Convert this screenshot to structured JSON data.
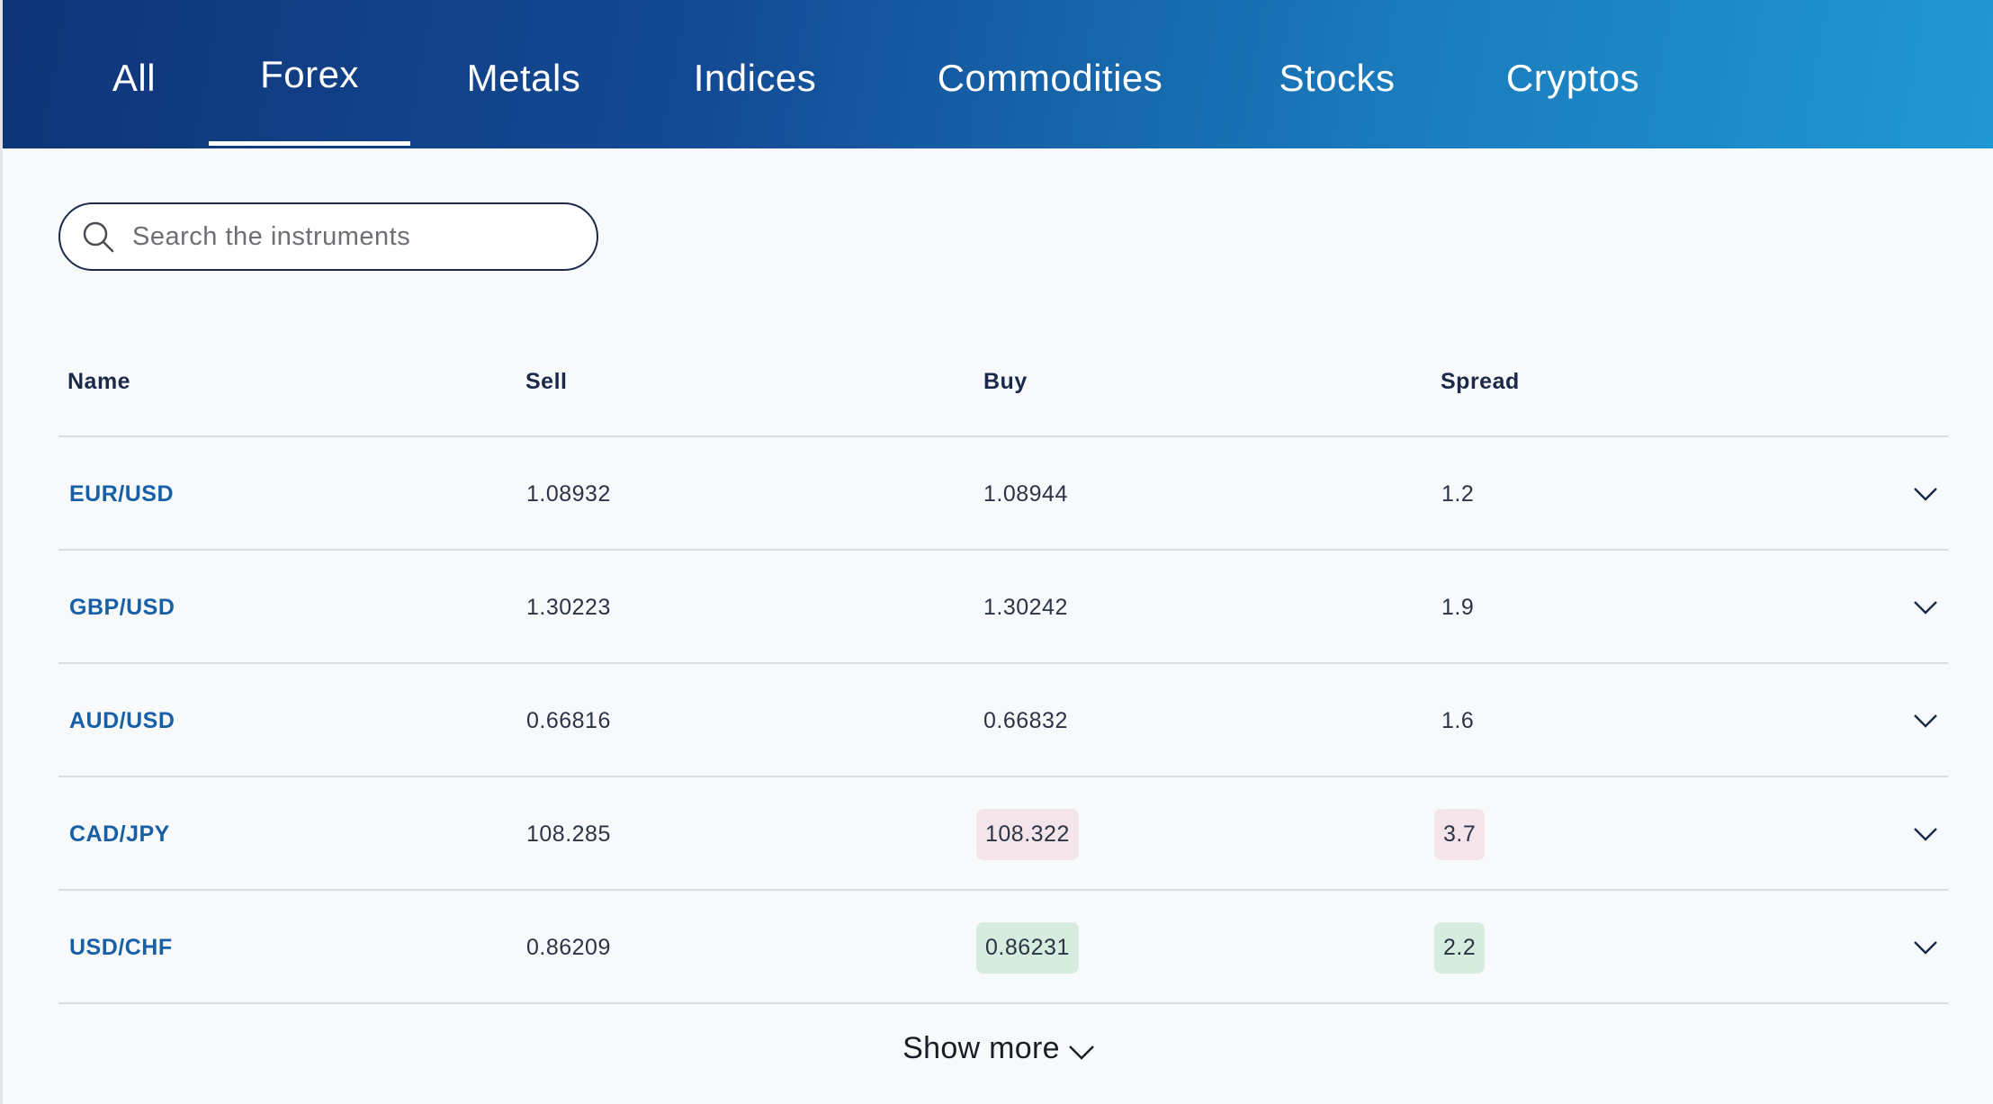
{
  "tabs": [
    {
      "label": "All",
      "active": false
    },
    {
      "label": "Forex",
      "active": true
    },
    {
      "label": "Metals",
      "active": false
    },
    {
      "label": "Indices",
      "active": false
    },
    {
      "label": "Commodities",
      "active": false
    },
    {
      "label": "Stocks",
      "active": false
    },
    {
      "label": "Cryptos",
      "active": false
    }
  ],
  "search": {
    "placeholder": "Search the instruments",
    "value": "",
    "icon": "search-icon"
  },
  "table": {
    "columns": [
      "Name",
      "Sell",
      "Buy",
      "Spread"
    ],
    "rows": [
      {
        "name": "EUR/USD",
        "sell": "1.08932",
        "buy": "1.08944",
        "spread": "1.2",
        "highlight": "none"
      },
      {
        "name": "GBP/USD",
        "sell": "1.30223",
        "buy": "1.30242",
        "spread": "1.9",
        "highlight": "none"
      },
      {
        "name": "AUD/USD",
        "sell": "0.66816",
        "buy": "0.66832",
        "spread": "1.6",
        "highlight": "none"
      },
      {
        "name": "CAD/JPY",
        "sell": "108.285",
        "buy": "108.322",
        "spread": "3.7",
        "highlight": "red"
      },
      {
        "name": "USD/CHF",
        "sell": "0.86209",
        "buy": "0.86231",
        "spread": "2.2",
        "highlight": "green"
      }
    ],
    "row_icon": "chevron-down-icon"
  },
  "show_more": {
    "label": "Show more",
    "icon": "chevron-down-icon"
  },
  "colors": {
    "header_start": "#0f3478",
    "header_end": "#2098d2",
    "instrument_link": "#1760a8",
    "highlight_red": "#f3e5ea",
    "highlight_green": "#d5ecdf"
  }
}
